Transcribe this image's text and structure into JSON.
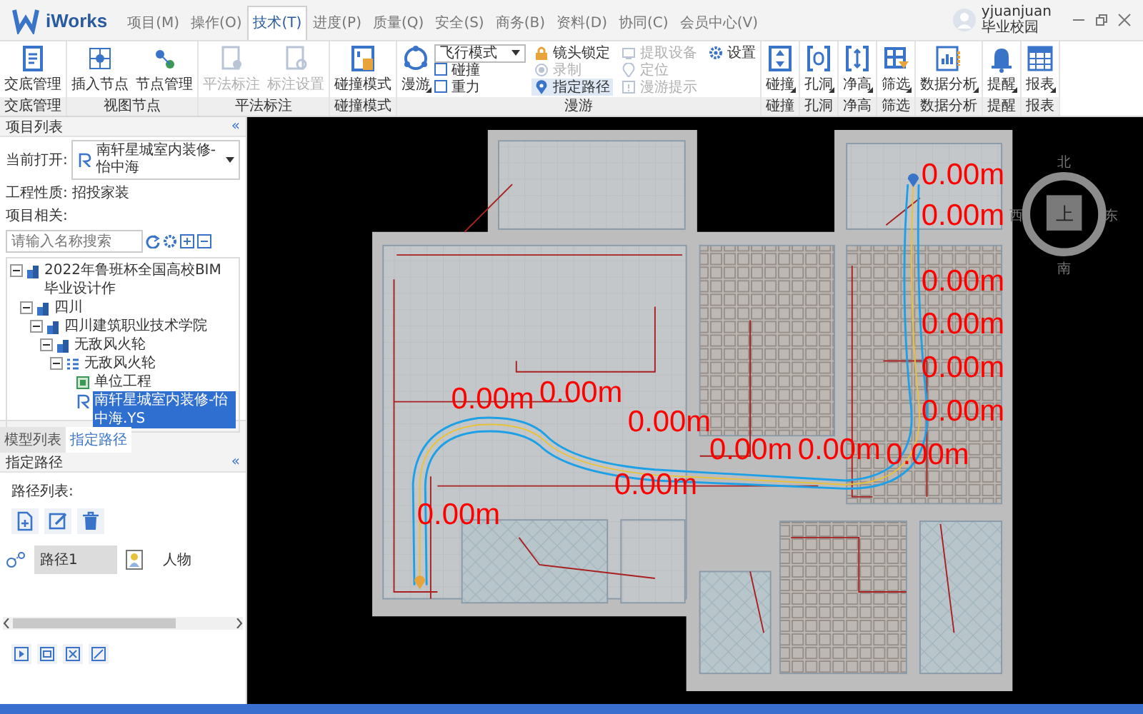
{
  "window": {
    "app_name": "iWorks"
  },
  "menu_tabs": [
    {
      "label": "项目(M)",
      "selected": false
    },
    {
      "label": "操作(O)",
      "selected": false
    },
    {
      "label": "技术(T)",
      "selected": true
    },
    {
      "label": "进度(P)",
      "selected": false
    },
    {
      "label": "质量(Q)",
      "selected": false
    },
    {
      "label": "安全(S)",
      "selected": false
    },
    {
      "label": "商务(B)",
      "selected": false
    },
    {
      "label": "资料(D)",
      "selected": false
    },
    {
      "label": "协同(C)",
      "selected": false
    },
    {
      "label": "会员中心(V)",
      "selected": false
    }
  ],
  "user": {
    "name": "yjuanjuan",
    "subtitle": "毕业校园"
  },
  "ribbon": {
    "groups": [
      {
        "label": "交底管理",
        "items": [
          {
            "kind": "large",
            "label": "交底管理",
            "disabled": false,
            "menu": false
          }
        ]
      },
      {
        "label": "视图节点",
        "items": [
          {
            "kind": "large",
            "label": "插入节点",
            "disabled": false,
            "menu": false
          },
          {
            "kind": "large",
            "label": "节点管理",
            "disabled": false,
            "menu": false
          }
        ]
      },
      {
        "label": "平法标注",
        "items": [
          {
            "kind": "large",
            "label": "平法标注",
            "disabled": true,
            "menu": false
          },
          {
            "kind": "large",
            "label": "标注设置",
            "disabled": true,
            "menu": false
          }
        ]
      },
      {
        "label": "碰撞模式",
        "items": [
          {
            "kind": "large",
            "label": "碰撞模式",
            "disabled": false,
            "menu": false
          }
        ]
      },
      {
        "label": "漫游",
        "items": [
          {
            "kind": "large",
            "label": "漫游",
            "disabled": false,
            "menu": true
          },
          {
            "kind": "select",
            "value": "飞行模式"
          },
          {
            "kind": "checkbox",
            "label": "碰撞",
            "checked": false
          },
          {
            "kind": "checkbox",
            "label": "重力",
            "checked": false
          },
          {
            "kind": "small",
            "label": "镜头锁定",
            "disabled": false,
            "selected": false
          },
          {
            "kind": "small",
            "label": "录制",
            "disabled": true,
            "selected": false
          },
          {
            "kind": "small",
            "label": "指定路径",
            "disabled": false,
            "selected": true
          },
          {
            "kind": "small",
            "label": "提取设备",
            "disabled": true,
            "selected": false
          },
          {
            "kind": "small",
            "label": "定位",
            "disabled": true,
            "selected": false
          },
          {
            "kind": "small",
            "label": "漫游提示",
            "disabled": true,
            "selected": false
          },
          {
            "kind": "small",
            "label": "设置",
            "disabled": false,
            "selected": false
          }
        ]
      },
      {
        "label": "碰撞",
        "items": [
          {
            "kind": "large",
            "label": "碰撞",
            "disabled": false,
            "menu": true
          }
        ]
      },
      {
        "label": "孔洞",
        "items": [
          {
            "kind": "large",
            "label": "孔洞",
            "disabled": false,
            "menu": true
          }
        ]
      },
      {
        "label": "净高",
        "items": [
          {
            "kind": "large",
            "label": "净高",
            "disabled": false,
            "menu": true
          }
        ]
      },
      {
        "label": "筛选",
        "items": [
          {
            "kind": "large",
            "label": "筛选",
            "disabled": false,
            "menu": true
          }
        ]
      },
      {
        "label": "数据分析",
        "items": [
          {
            "kind": "large",
            "label": "数据分析",
            "disabled": false,
            "menu": true
          }
        ]
      },
      {
        "label": "提醒",
        "items": [
          {
            "kind": "large",
            "label": "提醒",
            "disabled": false,
            "menu": true
          }
        ]
      },
      {
        "label": "报表",
        "items": [
          {
            "kind": "large",
            "label": "报表",
            "disabled": false,
            "menu": true
          }
        ]
      }
    ]
  },
  "project_panel": {
    "title": "项目列表",
    "collapse": "«",
    "current_open": {
      "label": "当前打开:",
      "value": "南轩星城室内装修-怡中海"
    },
    "project_type": {
      "label": "工程性质:",
      "value": "招投家装"
    },
    "related_label": "项目相关:",
    "search": {
      "placeholder": "请输入名称搜索"
    },
    "tree": [
      {
        "label": "2022年鲁班杯全国高校BIM毕业设计作",
        "expanded": true,
        "selected": false,
        "children": [
          {
            "label": "四川",
            "expanded": true,
            "selected": false,
            "children": [
              {
                "label": "四川建筑职业技术学院",
                "expanded": true,
                "selected": false,
                "children": [
                  {
                    "label": "无敌风火轮",
                    "expanded": true,
                    "selected": false,
                    "children": [
                      {
                        "label": "无敌风火轮",
                        "expanded": true,
                        "selected": false,
                        "children": [
                          {
                            "label": "单位工程",
                            "selected": false
                          },
                          {
                            "label": "南轩星城室内装修-怡中海.YS",
                            "selected": true
                          }
                        ]
                      }
                    ]
                  }
                ]
              }
            ]
          }
        ]
      }
    ]
  },
  "bottom_tabs": [
    {
      "label": "模型列表",
      "selected": false
    },
    {
      "label": "指定路径",
      "selected": true
    }
  ],
  "path_panel": {
    "title": "指定路径",
    "collapse": "«",
    "list_label": "路径列表:",
    "paths": [
      {
        "name": "路径1",
        "type": "人物",
        "selected": true
      }
    ]
  },
  "viewport": {
    "distance_labels": [
      "0.00m",
      "0.00m",
      "0.00m",
      "0.00m",
      "0.00m",
      "0.00m",
      "0.00m",
      "0.00m",
      "0.00m",
      "0.00m",
      "0.00m",
      "0.00m",
      "0.00m",
      "0.00m"
    ],
    "compass": {
      "center": "上",
      "north": "北",
      "east": "东",
      "south": "南",
      "west": "西"
    }
  }
}
